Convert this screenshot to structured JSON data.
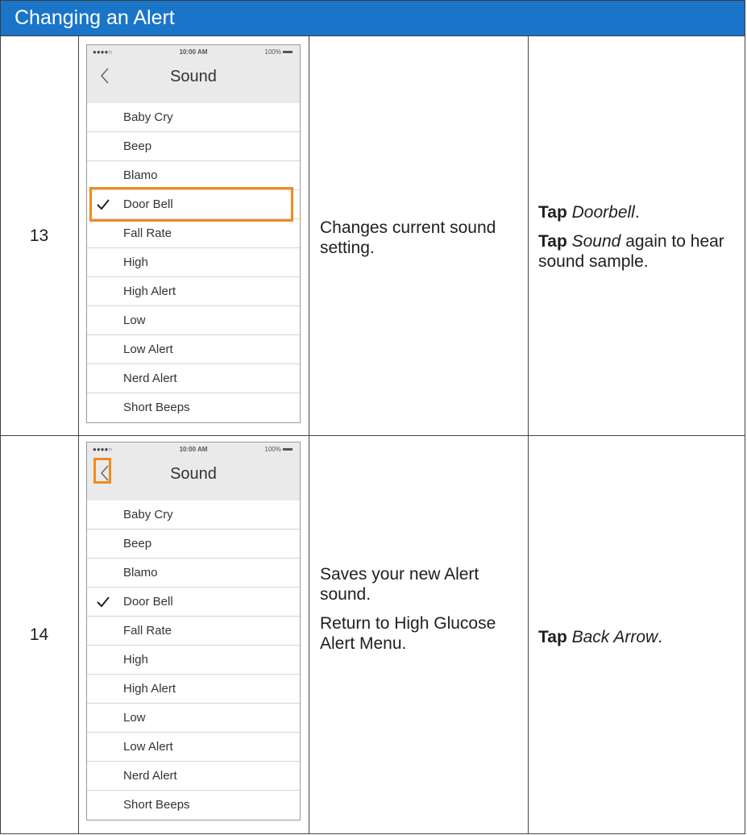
{
  "header": {
    "title": "Changing an Alert"
  },
  "steps": [
    {
      "number": "13",
      "screen": {
        "signal": "●●●●○",
        "time": "10:00 AM",
        "battery": "100%",
        "title": "Sound",
        "items": [
          "Baby Cry",
          "Beep",
          "Blamo",
          "Door Bell",
          "Fall Rate",
          "High",
          "High Alert",
          "Low",
          "Low Alert",
          "Nerd Alert",
          "Short Beeps"
        ],
        "checked": "Door Bell",
        "highlight": "Door Bell"
      },
      "description": [
        "Changes current sound setting."
      ],
      "action": [
        {
          "bold": "Tap",
          "italic": "Doorbell",
          "rest": "."
        },
        {
          "bold": "Tap",
          "italic": "Sound",
          "rest": " again to hear sound sample."
        }
      ]
    },
    {
      "number": "14",
      "screen": {
        "signal": "●●●●○",
        "time": "10:00 AM",
        "battery": "100%",
        "title": "Sound",
        "items": [
          "Baby Cry",
          "Beep",
          "Blamo",
          "Door Bell",
          "Fall Rate",
          "High",
          "High Alert",
          "Low",
          "Low Alert",
          "Nerd Alert",
          "Short Beeps"
        ],
        "checked": "Door Bell",
        "highlight": "back-arrow"
      },
      "description": [
        "Saves your new Alert sound.",
        "Return to High Glucose Alert Menu."
      ],
      "action": [
        {
          "bold": "Tap",
          "italic": "Back Arrow",
          "rest": "."
        }
      ]
    }
  ],
  "colors": {
    "header_bg": "#1a75c9",
    "highlight": "#f28a1b",
    "grid": "#444444"
  }
}
